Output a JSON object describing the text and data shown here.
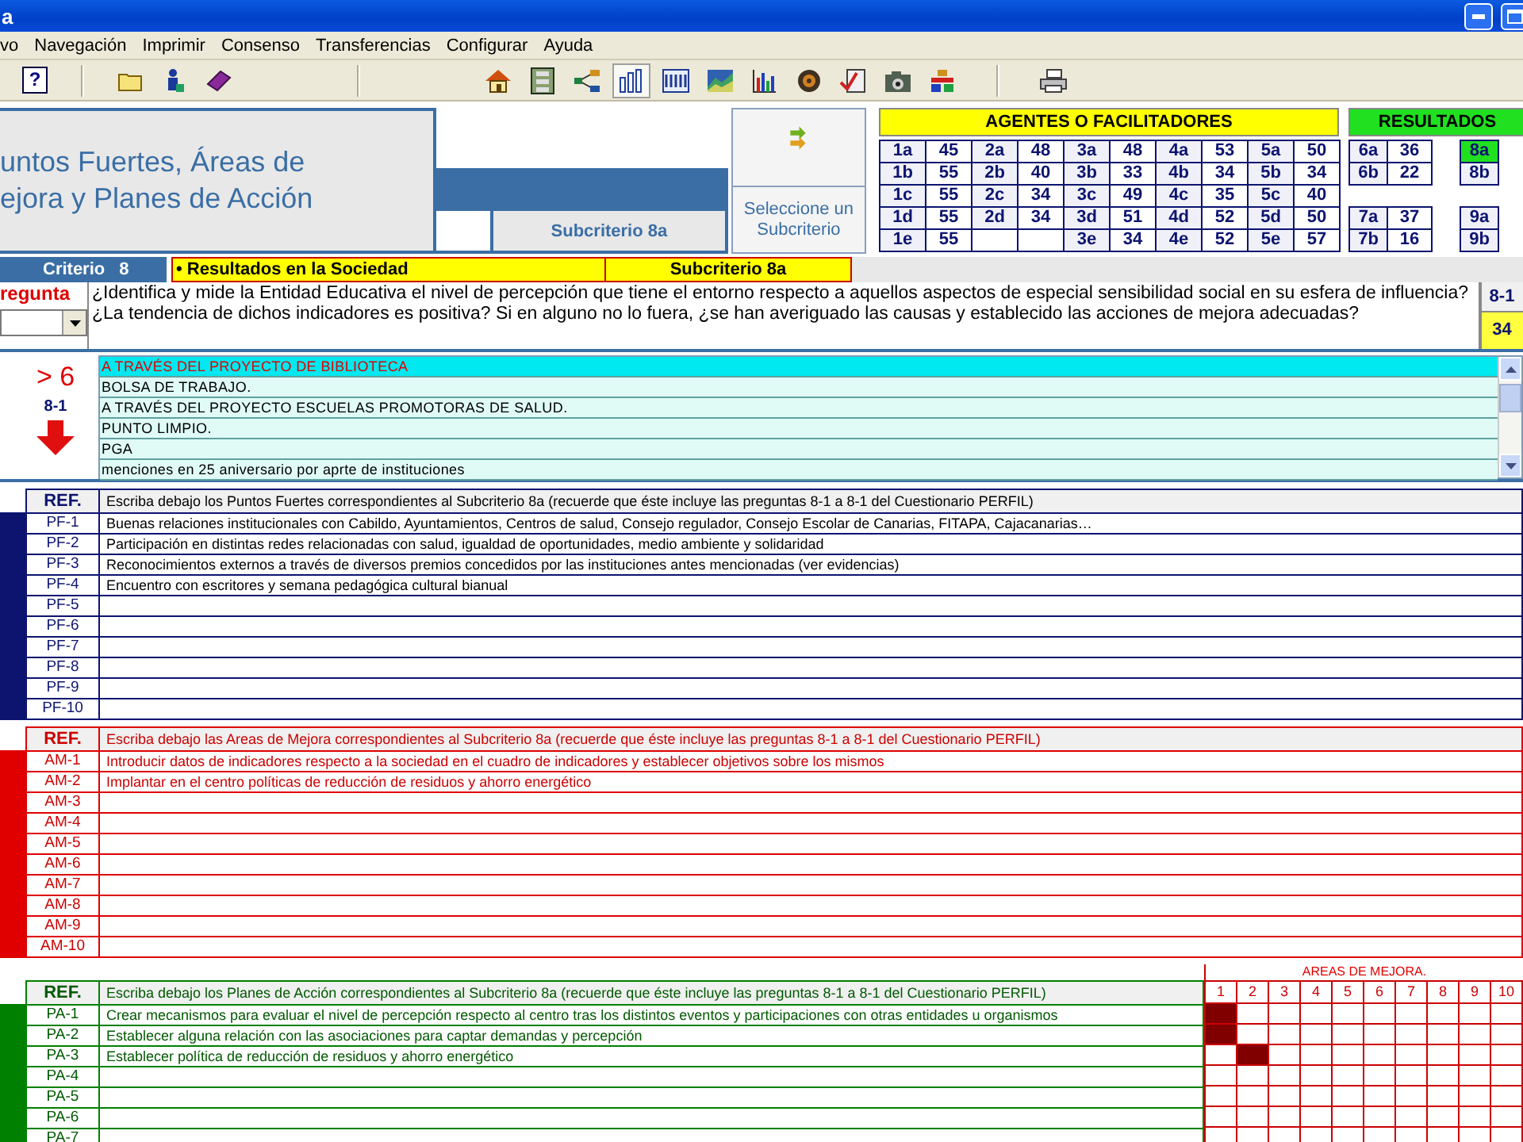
{
  "window": {
    "title": "a"
  },
  "menu": [
    "vo",
    "Navegación",
    "Imprimir",
    "Consenso",
    "Transferencias",
    "Configurar",
    "Ayuda"
  ],
  "toolbar": {
    "groups": [
      [
        {
          "kind": "help",
          "glyph": "?",
          "selected": false
        }
      ],
      [
        {
          "kind": "folder",
          "selected": false
        },
        {
          "kind": "figure",
          "selected": false
        },
        {
          "kind": "book",
          "selected": false
        }
      ],
      [
        {
          "kind": "home",
          "selected": false
        },
        {
          "kind": "flowchart",
          "selected": false
        },
        {
          "kind": "network",
          "selected": false
        },
        {
          "kind": "columns",
          "selected": true
        },
        {
          "kind": "logo",
          "selected": false
        },
        {
          "kind": "area-chart",
          "selected": false
        },
        {
          "kind": "bar-chart",
          "selected": false
        },
        {
          "kind": "disc",
          "selected": false
        },
        {
          "kind": "checklist",
          "selected": false
        },
        {
          "kind": "camera",
          "selected": false
        },
        {
          "kind": "stack",
          "selected": false
        }
      ],
      [
        {
          "kind": "printer",
          "selected": false
        }
      ]
    ]
  },
  "header": {
    "title_lines": [
      "untos Fuertes, Áreas de",
      "ejora y Planes de Acción"
    ],
    "subcriterio_label": "Subcriterio 8a",
    "select_button": "Seleccione un Subcriterio"
  },
  "agentes": {
    "title": "AGENTES O FACILITADORES",
    "rows": [
      [
        {
          "code": "1a",
          "value": "45",
          "selected": false
        },
        {
          "code": "2a",
          "value": "48",
          "selected": false
        },
        {
          "code": "3a",
          "value": "48",
          "selected": false
        },
        {
          "code": "4a",
          "value": "53",
          "selected": false
        },
        {
          "code": "5a",
          "value": "50",
          "selected": false
        }
      ],
      [
        {
          "code": "1b",
          "value": "55",
          "selected": false
        },
        {
          "code": "2b",
          "value": "40",
          "selected": false
        },
        {
          "code": "3b",
          "value": "33",
          "selected": false
        },
        {
          "code": "4b",
          "value": "34",
          "selected": false
        },
        {
          "code": "5b",
          "value": "34",
          "selected": false
        }
      ],
      [
        {
          "code": "1c",
          "value": "55",
          "selected": false
        },
        {
          "code": "2c",
          "value": "34",
          "selected": false
        },
        {
          "code": "3c",
          "value": "49",
          "selected": false
        },
        {
          "code": "4c",
          "value": "35",
          "selected": false
        },
        {
          "code": "5c",
          "value": "40",
          "selected": false
        }
      ],
      [
        {
          "code": "1d",
          "value": "55",
          "selected": false
        },
        {
          "code": "2d",
          "value": "34",
          "selected": false
        },
        {
          "code": "3d",
          "value": "51",
          "selected": false
        },
        {
          "code": "4d",
          "value": "52",
          "selected": false
        },
        {
          "code": "5d",
          "value": "50",
          "selected": false
        }
      ],
      [
        {
          "code": "1e",
          "value": "55",
          "selected": false
        },
        null,
        {
          "code": "3e",
          "value": "34",
          "selected": false
        },
        {
          "code": "4e",
          "value": "52",
          "selected": false
        },
        {
          "code": "5e",
          "value": "57",
          "selected": false
        }
      ]
    ]
  },
  "resultados": {
    "title": "RESULTADOS",
    "rows": [
      [
        {
          "code": "6a",
          "value": "36",
          "selected": false
        },
        {
          "code": "8a",
          "selected": true
        }
      ],
      [
        {
          "code": "6b",
          "value": "22",
          "selected": false
        },
        {
          "code": "8b",
          "selected": false
        }
      ],
      [
        null,
        null
      ],
      [
        {
          "code": "7a",
          "value": "37",
          "selected": false
        },
        {
          "code": "9a",
          "selected": false
        }
      ],
      [
        {
          "code": "7b",
          "value": "16",
          "selected": false
        },
        {
          "code": "9b",
          "selected": false
        }
      ]
    ]
  },
  "criteria": {
    "label": "Criterio",
    "number": "8",
    "name": "• Resultados en la Sociedad",
    "subcriterio": "Subcriterio 8a"
  },
  "question": {
    "label": "regunta",
    "lines": [
      "¿Identifica y mide la Entidad Educativa el nivel de percepción que tiene el entorno respecto a aquellos aspectos de especial sensibilidad social en su esfera de influencia?",
      "¿La tendencia de dichos indicadores es positiva? Si en alguno no lo fuera, ¿se han averiguado las causas y establecido las acciones de mejora adecuadas?"
    ],
    "code": "8-1",
    "score": "34"
  },
  "answers": {
    "count": "> 6",
    "code": "8-1",
    "items": [
      {
        "text": "A TRAVÉS DEL PROYECTO DE BIBLIOTECA",
        "selected": true
      },
      {
        "text": "BOLSA DE TRABAJO.",
        "selected": false
      },
      {
        "text": "A TRAVÉS DEL PROYECTO ESCUELAS PROMOTORAS DE SALUD.",
        "selected": false
      },
      {
        "text": "PUNTO LIMPIO.",
        "selected": false
      },
      {
        "text": "PGA",
        "selected": false
      },
      {
        "text": "menciones en 25 aniversario por aprte de instituciones",
        "selected": false
      }
    ]
  },
  "sections": [
    {
      "kind": "strengths",
      "color": "#0c1470",
      "ref_heading": "REF.",
      "instruction": "Escriba debajo los Puntos Fuertes correspondientes al Subcriterio 8a (recuerde que éste incluye las preguntas 8-1 a 8-1 del Cuestionario PERFIL)",
      "rows": [
        {
          "ref": "PF-1",
          "text": "Buenas relaciones institucionales con Cabildo, Ayuntamientos, Centros de salud, Consejo regulador, Consejo Escolar de Canarias, FITAPA, Cajacanarias…"
        },
        {
          "ref": "PF-2",
          "text": "Participación en distintas redes relacionadas con salud, igualdad de oportunidades, medio ambiente y solidaridad"
        },
        {
          "ref": "PF-3",
          "text": "Reconocimientos externos a través de diversos premios concedidos por las instituciones antes mencionadas (ver evidencias)"
        },
        {
          "ref": "PF-4",
          "text": "Encuentro con escritores y semana pedagógica cultural bianual"
        },
        {
          "ref": "PF-5"
        },
        {
          "ref": "PF-6"
        },
        {
          "ref": "PF-7"
        },
        {
          "ref": "PF-8"
        },
        {
          "ref": "PF-9"
        },
        {
          "ref": "PF-10"
        }
      ]
    },
    {
      "kind": "improvements",
      "color": "#e00000",
      "ref_heading": "REF.",
      "instruction": "Escriba debajo las Areas de Mejora correspondientes al Subcriterio 8a (recuerde que éste incluye las preguntas 8-1 a 8-1 del Cuestionario PERFIL)",
      "rows": [
        {
          "ref": "AM-1",
          "text": "Introducir datos de indicadores respecto a la sociedad en el cuadro de indicadores y establecer objetivos sobre los mismos"
        },
        {
          "ref": "AM-2",
          "text": "Implantar en el centro políticas de reducción de residuos y ahorro energético"
        },
        {
          "ref": "AM-3"
        },
        {
          "ref": "AM-4"
        },
        {
          "ref": "AM-5"
        },
        {
          "ref": "AM-6"
        },
        {
          "ref": "AM-7"
        },
        {
          "ref": "AM-8"
        },
        {
          "ref": "AM-9"
        },
        {
          "ref": "AM-10"
        }
      ]
    },
    {
      "kind": "actions",
      "color": "#008000",
      "ref_heading": "REF.",
      "instruction": "Escriba debajo los Planes de Acción correspondientes al Subcriterio 8a (recuerde que éste incluye las preguntas 8-1 a 8-1 del Cuestionario PERFIL)",
      "rows": [
        {
          "ref": "PA-1",
          "text": "Crear mecanismos para evaluar el nivel de percepción respecto al centro tras los distintos eventos y participaciones con otras entidades u organismos"
        },
        {
          "ref": "PA-2",
          "text": "Establecer alguna relación con las asociaciones  para captar demandas y percepción"
        },
        {
          "ref": "PA-3",
          "text": "Establecer política de reducción de residuos y ahorro energético"
        },
        {
          "ref": "PA-4"
        },
        {
          "ref": "PA-5"
        },
        {
          "ref": "PA-6"
        },
        {
          "ref": "PA-7"
        }
      ],
      "matrix": {
        "title": "AREAS DE MEJORA.",
        "columns": [
          "1",
          "2",
          "3",
          "4",
          "5",
          "6",
          "7",
          "8",
          "9",
          "10"
        ],
        "rows": [
          [
            true,
            false,
            false,
            false,
            false,
            false,
            false,
            false,
            false,
            false
          ],
          [
            true,
            false,
            false,
            false,
            false,
            false,
            false,
            false,
            false,
            false
          ],
          [
            false,
            true,
            false,
            false,
            false,
            false,
            false,
            false,
            false,
            false
          ],
          [
            false,
            false,
            false,
            false,
            false,
            false,
            false,
            false,
            false,
            false
          ],
          [
            false,
            false,
            false,
            false,
            false,
            false,
            false,
            false,
            false,
            false
          ],
          [
            false,
            false,
            false,
            false,
            false,
            false,
            false,
            false,
            false,
            false
          ],
          [
            false,
            false,
            false,
            false,
            false,
            false,
            false,
            false,
            false,
            false
          ]
        ]
      }
    }
  ]
}
